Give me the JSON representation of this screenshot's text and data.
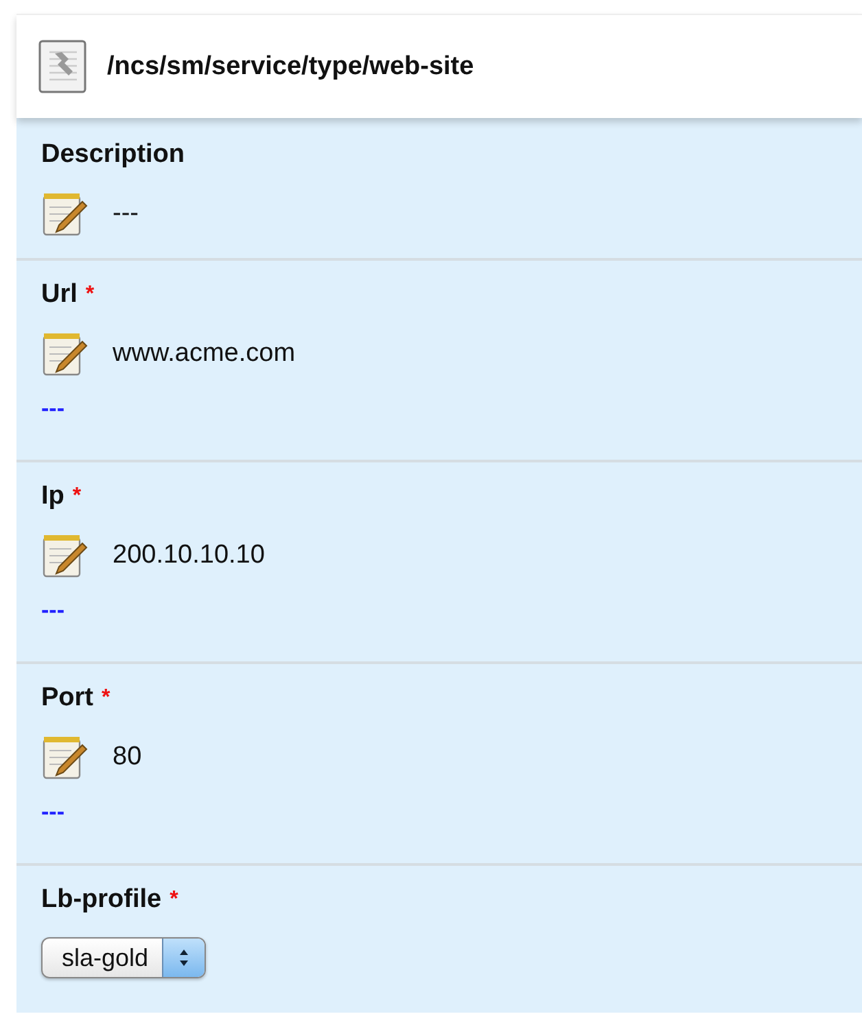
{
  "header": {
    "path": "/ncs/sm/service/type/web-site"
  },
  "fields": [
    {
      "kind": "text",
      "label": "Description",
      "value": "---"
    },
    {
      "kind": "text",
      "label": "Url",
      "required_mark": "*",
      "value": "www.acme.com",
      "link": "---"
    },
    {
      "kind": "text",
      "label": "Ip",
      "required_mark": "*",
      "value": "200.10.10.10",
      "link": "---"
    },
    {
      "kind": "text",
      "label": "Port",
      "required_mark": "*",
      "value": "80",
      "link": "---"
    },
    {
      "kind": "select",
      "label": "Lb-profile",
      "required_mark": "*",
      "value": "sla-gold"
    }
  ]
}
